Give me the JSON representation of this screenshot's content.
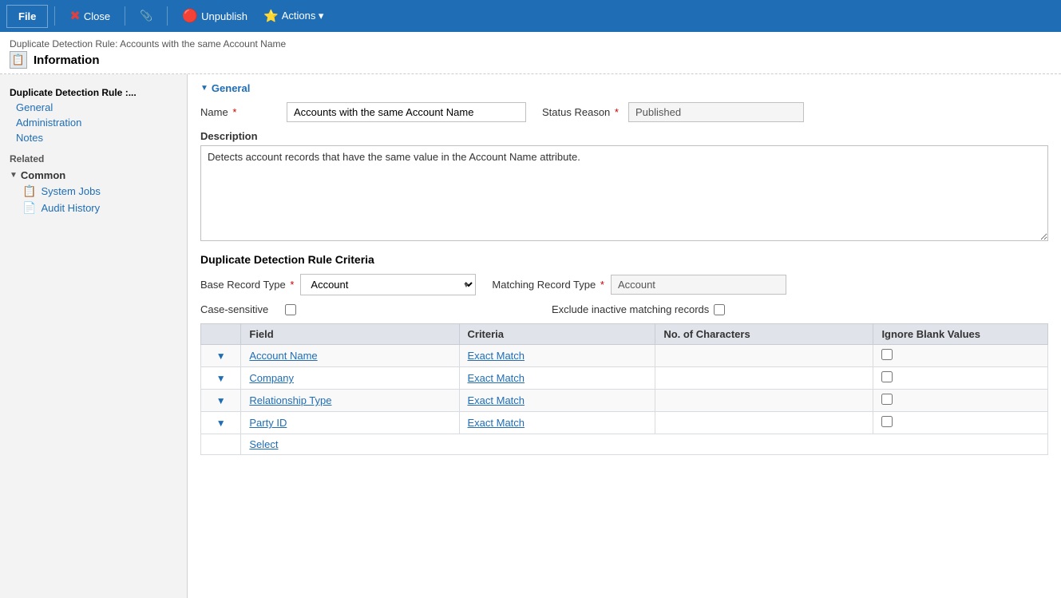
{
  "toolbar": {
    "file_label": "File",
    "close_label": "Close",
    "attachment_icon": "📎",
    "unpublish_label": "Unpublish",
    "actions_label": "Actions ▾"
  },
  "header": {
    "breadcrumb": "Duplicate Detection Rule: Accounts with the same Account Name",
    "page_title": "Information",
    "page_icon": "📄"
  },
  "sidebar": {
    "section_title": "Duplicate Detection Rule :...",
    "nav_items": [
      {
        "label": "General",
        "id": "general"
      },
      {
        "label": "Administration",
        "id": "administration"
      },
      {
        "label": "Notes",
        "id": "notes"
      }
    ],
    "related_label": "Related",
    "common_group": "Common",
    "common_items": [
      {
        "label": "System Jobs",
        "icon": "📋",
        "id": "system-jobs"
      },
      {
        "label": "Audit History",
        "icon": "📄",
        "id": "audit-history"
      }
    ]
  },
  "general_section": {
    "title": "General",
    "name_label": "Name",
    "name_value": "Accounts with the same Account Name",
    "name_placeholder": "Accounts with the same Account Name",
    "status_reason_label": "Status Reason",
    "status_reason_value": "Published",
    "description_label": "Description",
    "description_value": "Detects account records that have the same value in the Account Name attribute."
  },
  "criteria_section": {
    "title": "Duplicate Detection Rule Criteria",
    "base_record_type_label": "Base Record Type",
    "base_record_type_value": "Account",
    "matching_record_type_label": "Matching Record Type",
    "matching_record_type_value": "Account",
    "case_sensitive_label": "Case-sensitive",
    "exclude_inactive_label": "Exclude inactive matching records",
    "table": {
      "headers": [
        "",
        "Field",
        "Criteria",
        "No. of Characters",
        "Ignore Blank Values"
      ],
      "rows": [
        {
          "expand": "▼",
          "field": "Account Name",
          "criteria": "Exact Match",
          "chars": "",
          "ignore": false
        },
        {
          "expand": "▼",
          "field": "Company",
          "criteria": "Exact Match",
          "chars": "",
          "ignore": false
        },
        {
          "expand": "▼",
          "field": "Relationship Type",
          "criteria": "Exact Match",
          "chars": "",
          "ignore": false
        },
        {
          "expand": "▼",
          "field": "Party ID",
          "criteria": "Exact Match",
          "chars": "",
          "ignore": false
        }
      ],
      "select_link": "Select"
    }
  }
}
